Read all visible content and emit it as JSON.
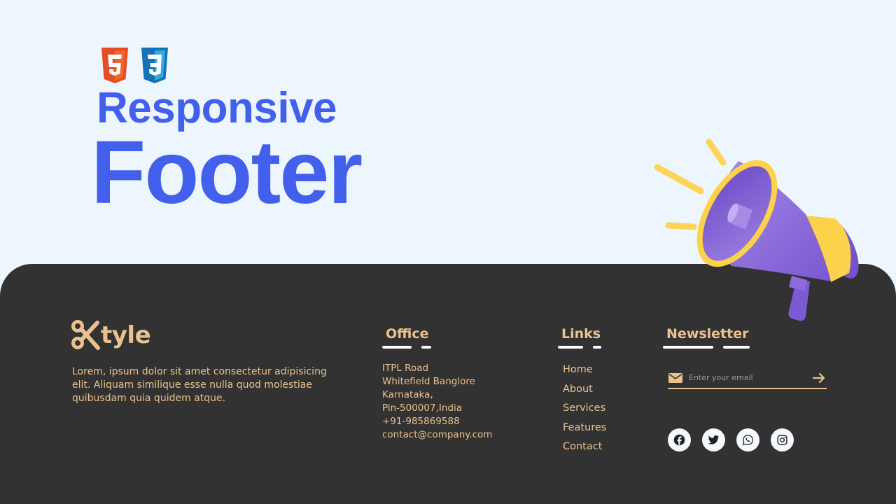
{
  "hero": {
    "badges": [
      {
        "name": "html5",
        "label": "5",
        "color": "#e44d26",
        "shade": "#f16529"
      },
      {
        "name": "css3",
        "label": "3",
        "color": "#1572b6",
        "shade": "#33a9dc"
      }
    ],
    "title_line1": "Responsive",
    "title_line2": "Footer",
    "title_color": "#4360ec",
    "illustration": "megaphone-icon"
  },
  "footer": {
    "background": "#323232",
    "accent_color": "#ebc28e",
    "brand": {
      "icon": "scissors-icon",
      "name": "tyle"
    },
    "about_text": "Lorem, ipsum dolor sit amet consectetur adipisicing elit. Aliquam similique esse nulla quod molestiae quibusdam quia quidem atque.",
    "office": {
      "title": "Office",
      "lines": [
        "ITPL Road",
        "Whitefield Banglore",
        "Karnataka,",
        "Pin-500007,India",
        "+91-985869588",
        "contact@company.com"
      ]
    },
    "links": {
      "title": "Links",
      "items": [
        "Home",
        "About",
        "Services",
        "Features",
        "Contact"
      ]
    },
    "newsletter": {
      "title": "Newsletter",
      "email_placeholder": "Enter your email",
      "email_value": "",
      "mail_icon": "envelope-icon",
      "submit_icon": "arrow-right-icon"
    },
    "socials": [
      {
        "name": "facebook",
        "icon": "facebook-icon"
      },
      {
        "name": "twitter",
        "icon": "twitter-icon"
      },
      {
        "name": "whatsapp",
        "icon": "whatsapp-icon"
      },
      {
        "name": "instagram",
        "icon": "instagram-icon"
      }
    ]
  }
}
